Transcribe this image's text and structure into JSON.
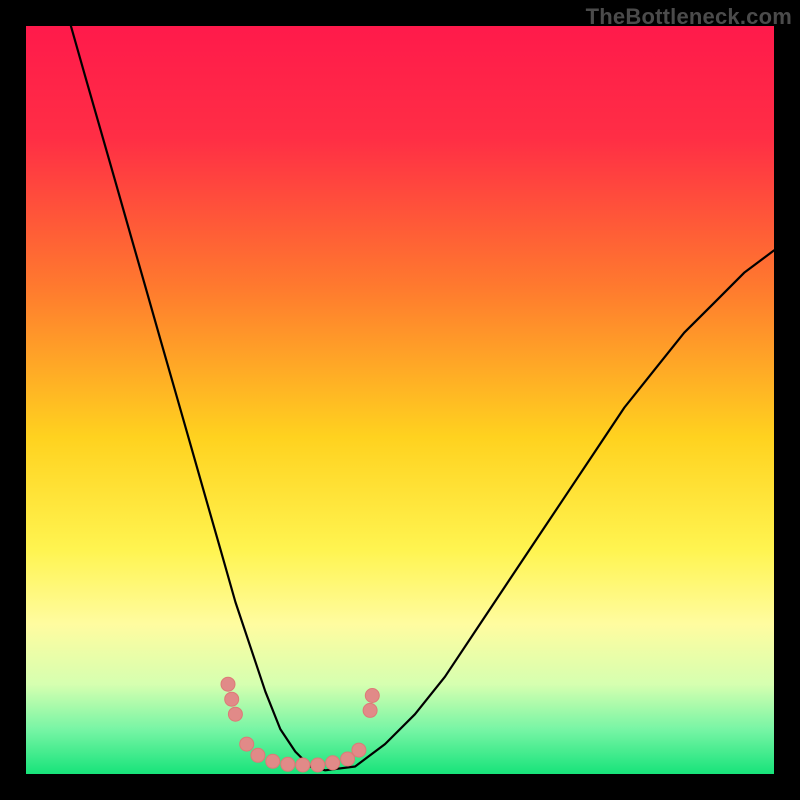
{
  "watermark": "TheBottleneck.com",
  "chart_data": {
    "type": "line",
    "title": "",
    "xlabel": "",
    "ylabel": "",
    "xlim": [
      0,
      100
    ],
    "ylim": [
      0,
      100
    ],
    "grid": false,
    "legend": false,
    "gradient_stops": [
      {
        "offset": 0.0,
        "color": "#ff1a4b"
      },
      {
        "offset": 0.15,
        "color": "#ff2e45"
      },
      {
        "offset": 0.35,
        "color": "#ff7a2e"
      },
      {
        "offset": 0.55,
        "color": "#ffd21f"
      },
      {
        "offset": 0.7,
        "color": "#fff450"
      },
      {
        "offset": 0.8,
        "color": "#fffca0"
      },
      {
        "offset": 0.88,
        "color": "#d6ffb0"
      },
      {
        "offset": 0.94,
        "color": "#78f5a5"
      },
      {
        "offset": 1.0,
        "color": "#17e37a"
      }
    ],
    "series": [
      {
        "name": "bottleneck-curve",
        "stroke": "#000000",
        "stroke_width": 2.2,
        "x": [
          6,
          8,
          10,
          12,
          14,
          16,
          18,
          20,
          22,
          24,
          26,
          28,
          30,
          32,
          34,
          36,
          38,
          40,
          44,
          48,
          52,
          56,
          60,
          64,
          68,
          72,
          76,
          80,
          84,
          88,
          92,
          96,
          100
        ],
        "y": [
          100,
          93,
          86,
          79,
          72,
          65,
          58,
          51,
          44,
          37,
          30,
          23,
          17,
          11,
          6,
          3,
          1,
          0.5,
          1,
          4,
          8,
          13,
          19,
          25,
          31,
          37,
          43,
          49,
          54,
          59,
          63,
          67,
          70
        ]
      },
      {
        "name": "highlight-dots",
        "type": "scatter",
        "fill": "#e18a88",
        "stroke": "#dd7a77",
        "radius": 7,
        "points": [
          {
            "x": 27.0,
            "y": 12.0
          },
          {
            "x": 27.5,
            "y": 10.0
          },
          {
            "x": 28.0,
            "y": 8.0
          },
          {
            "x": 29.5,
            "y": 4.0
          },
          {
            "x": 31.0,
            "y": 2.5
          },
          {
            "x": 33.0,
            "y": 1.7
          },
          {
            "x": 35.0,
            "y": 1.3
          },
          {
            "x": 37.0,
            "y": 1.2
          },
          {
            "x": 39.0,
            "y": 1.2
          },
          {
            "x": 41.0,
            "y": 1.5
          },
          {
            "x": 43.0,
            "y": 2.0
          },
          {
            "x": 44.5,
            "y": 3.2
          },
          {
            "x": 46.0,
            "y": 8.5
          },
          {
            "x": 46.3,
            "y": 10.5
          }
        ]
      }
    ]
  }
}
